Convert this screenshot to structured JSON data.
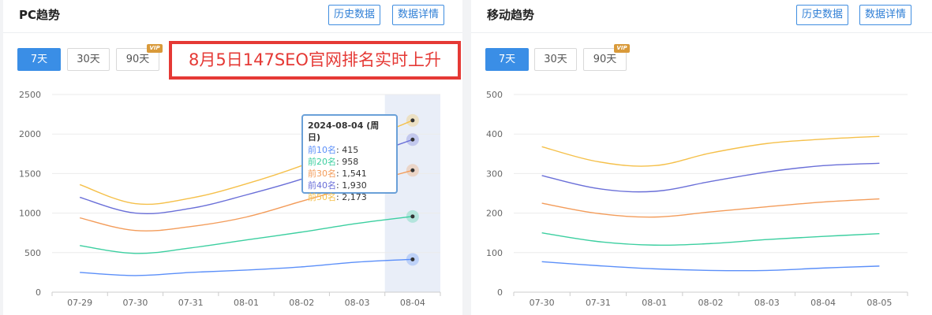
{
  "pc_panel": {
    "title": "PC趋势",
    "history_button": "历史数据",
    "detail_button": "数据详情",
    "ranges": [
      "7天",
      "30天",
      "90天"
    ],
    "active_range": 0,
    "vip_badge": "VIP",
    "banner_text": "8月5日147SEO官网排名实时上升",
    "tooltip": {
      "date": "2024-08-04 (周日)",
      "rows": [
        {
          "label": "前10名",
          "value": "415",
          "color": "#5b8ff9"
        },
        {
          "label": "前20名",
          "value": "958",
          "color": "#3ccfa0"
        },
        {
          "label": "前30名",
          "value": "1,541",
          "color": "#f39c5a"
        },
        {
          "label": "前40名",
          "value": "1,930",
          "color": "#6a6fd8"
        },
        {
          "label": "前50名",
          "value": "2,173",
          "color": "#f5c04a"
        }
      ]
    }
  },
  "mobile_panel": {
    "title": "移动趋势",
    "history_button": "历史数据",
    "detail_button": "数据详情",
    "ranges": [
      "7天",
      "30天",
      "90天"
    ],
    "active_range": 0,
    "vip_badge": "VIP"
  },
  "chart_data": [
    {
      "type": "line",
      "x": [
        "07-29",
        "07-30",
        "07-31",
        "08-01",
        "08-02",
        "08-03",
        "08-04"
      ],
      "ylim": [
        0,
        2500
      ],
      "yticks": [
        0,
        500,
        1000,
        1500,
        2000,
        2500
      ],
      "highlight_index": 6,
      "series": [
        {
          "name": "前10名",
          "color": "#5b8ff9",
          "values": [
            250,
            210,
            250,
            280,
            320,
            380,
            415
          ]
        },
        {
          "name": "前20名",
          "color": "#3ccfa0",
          "values": [
            590,
            490,
            560,
            660,
            760,
            870,
            958
          ]
        },
        {
          "name": "前30名",
          "color": "#f39c5a",
          "values": [
            940,
            780,
            830,
            950,
            1150,
            1350,
            1541
          ]
        },
        {
          "name": "前40名",
          "color": "#6a6fd8",
          "values": [
            1200,
            1000,
            1060,
            1230,
            1430,
            1680,
            1930
          ]
        },
        {
          "name": "前50名",
          "color": "#f5c04a",
          "values": [
            1360,
            1120,
            1190,
            1370,
            1600,
            1880,
            2173
          ]
        }
      ]
    },
    {
      "type": "line",
      "x": [
        "07-30",
        "07-31",
        "08-01",
        "08-02",
        "08-03",
        "08-04",
        "08-05"
      ],
      "ylim": [
        0,
        500
      ],
      "yticks": [
        0,
        100,
        200,
        300,
        400,
        500
      ],
      "series": [
        {
          "name": "前10名",
          "color": "#5b8ff9",
          "values": [
            77,
            67,
            59,
            55,
            55,
            61,
            66
          ]
        },
        {
          "name": "前20名",
          "color": "#3ccfa0",
          "values": [
            150,
            128,
            119,
            123,
            133,
            141,
            148
          ]
        },
        {
          "name": "前30名",
          "color": "#f39c5a",
          "values": [
            225,
            199,
            190,
            203,
            216,
            228,
            236
          ]
        },
        {
          "name": "前40名",
          "color": "#6a6fd8",
          "values": [
            295,
            262,
            255,
            280,
            304,
            320,
            326
          ]
        },
        {
          "name": "前50名",
          "color": "#f5c04a",
          "values": [
            368,
            330,
            320,
            352,
            376,
            387,
            394
          ]
        }
      ]
    }
  ]
}
